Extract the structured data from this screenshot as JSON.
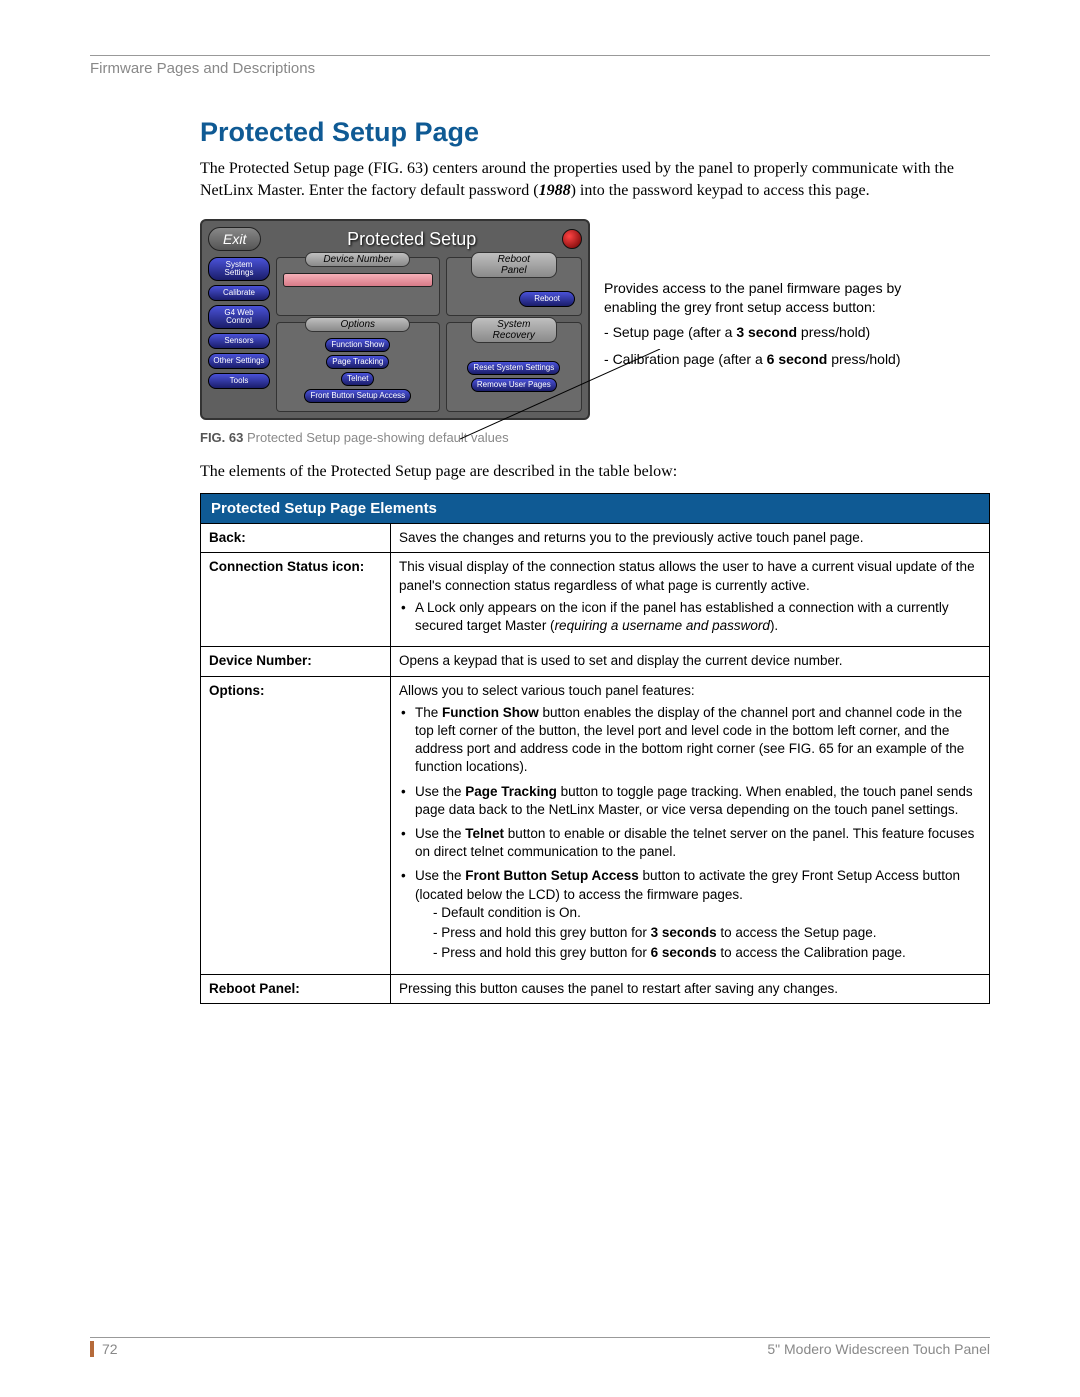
{
  "header": {
    "section": "Firmware Pages and Descriptions"
  },
  "title": "Protected Setup Page",
  "intro": {
    "pre": "The Protected Setup page (FIG. 63) centers around the properties used by the panel to properly communicate with the NetLinx Master. Enter the factory default password (",
    "pw": "1988",
    "post": ") into the password keypad to access this page."
  },
  "panel": {
    "exit": "Exit",
    "title": "Protected Setup",
    "side": [
      "System Settings",
      "Calibrate",
      "G4 Web Control",
      "Sensors",
      "Other Settings",
      "Tools"
    ],
    "devnum_label": "Device Number",
    "reboot_label": "Reboot Panel",
    "options_label": "Options",
    "options_items": [
      "Function Show",
      "Page Tracking",
      "Telnet",
      "Front Button Setup Access"
    ],
    "reboot_btn": "Reboot",
    "sysrec_label": "System Recovery",
    "sysrec_items": [
      "Reset System Settings",
      "Remove User Pages"
    ]
  },
  "annotation": {
    "intro": "Provides access to the panel firmware pages by enabling the grey front setup access button:",
    "items": [
      {
        "pre": "Setup page (after a ",
        "b": "3 second",
        "post": " press/hold)"
      },
      {
        "pre": "Calibration page (after a ",
        "b": "6 second",
        "post": " press/hold)"
      }
    ]
  },
  "caption": {
    "fignum": "FIG. 63",
    "text": " Protected Setup page-showing default values"
  },
  "leadin": "The elements of the Protected Setup page are described in the table below:",
  "table": {
    "header": "Protected Setup Page Elements",
    "rows": {
      "back": {
        "k": "Back:",
        "v": "Saves the changes and returns you to the previously active touch panel page."
      },
      "conn": {
        "k": "Connection Status icon:",
        "v": "This visual display of the connection status allows the user to have a current visual update of the panel's connection status regardless of what page is currently active.",
        "b1a": "A Lock only appears on the icon if the panel has established a connection with a currently secured target Master (",
        "b1i": "requiring a username and password",
        "b1z": ")."
      },
      "devnum": {
        "k": "Device Number:",
        "v": "Opens a keypad that is used to set and display the current device number."
      },
      "options": {
        "k": "Options:",
        "v": "Allows you to select various touch panel features:",
        "li1a": "The ",
        "li1b": "Function Show",
        "li1c": " button enables the display of the channel port and channel code in the top left corner of the button, the level port and level code in the bottom left corner, and the address port and address code in the bottom right corner (see FIG. 65 for an example of the function locations).",
        "li2a": "Use the ",
        "li2b": "Page Tracking",
        "li2c": " button to toggle page tracking. When enabled, the touch panel sends page data back to the NetLinx Master, or vice versa depending on the touch panel settings.",
        "li3a": "Use the ",
        "li3b": "Telnet",
        "li3c": " button to enable or disable the telnet server on the panel. This feature focuses on direct telnet communication to the panel.",
        "li4a": "Use the ",
        "li4b": "Front Button Setup Access",
        "li4c": " button to activate the grey Front Setup Access button (located below the LCD) to access the firmware pages.",
        "s1": "- Default condition is On.",
        "s2a": "- Press and hold this grey button for ",
        "s2b": "3 seconds",
        "s2c": " to access the Setup page.",
        "s3a": "- Press and hold this grey button for ",
        "s3b": "6 seconds",
        "s3c": " to access the Calibration page."
      },
      "reboot": {
        "k": "Reboot Panel:",
        "v": "Pressing this button causes the panel to restart after saving any changes."
      }
    }
  },
  "footer": {
    "page": "72",
    "doc": "5\" Modero Widescreen Touch Panel"
  }
}
